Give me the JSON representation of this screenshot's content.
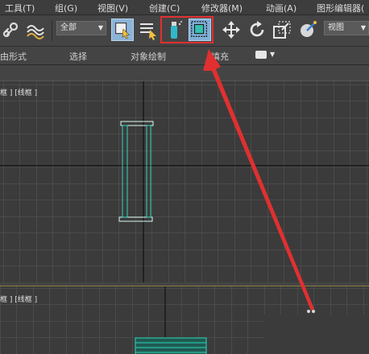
{
  "menubar": {
    "items": [
      "工具(T)",
      "组(G)",
      "视图(V)",
      "创建(C)",
      "修改器(M)",
      "动画(A)",
      "图形编辑器("
    ]
  },
  "toolbar": {
    "filter_dropdown": "全部",
    "view_dropdown": "视图",
    "icons": [
      "link-icon",
      "bind-spacewarp-icon",
      "select-object-icon",
      "select-by-name-icon",
      "paint-selection-icon",
      "window-crossing-icon",
      "move-icon",
      "rotate-icon",
      "scale-icon",
      "view-coordinate-icon"
    ]
  },
  "ribbon": {
    "items": [
      "由形式",
      "选择",
      "对象绘制",
      "填充"
    ]
  },
  "viewports": {
    "top_label": "框 ] [线框 ]",
    "bottom_label": "框 ] [线框 ]"
  },
  "colors": {
    "highlight": "#e03030",
    "object": "#2fd6b8",
    "grid": "#5a5a5a",
    "axis": "#101010"
  }
}
